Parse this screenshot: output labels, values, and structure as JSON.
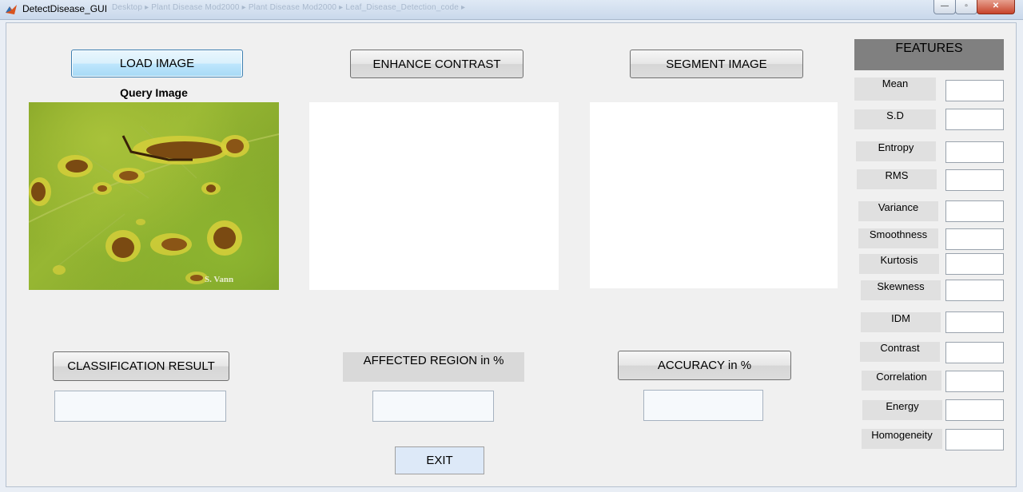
{
  "window": {
    "title": "DetectDisease_GUI",
    "ghost_path": "Desktop  ▸  Plant Disease Mod2000  ▸  Plant Disease Mod2000  ▸  Leaf_Disease_Detection_code  ▸",
    "controls": {
      "minimize": "—",
      "maximize": "▫",
      "close": "✕"
    }
  },
  "buttons": {
    "load_image": "LOAD IMAGE",
    "enhance_contrast": "ENHANCE CONTRAST",
    "segment_image": "SEGMENT IMAGE",
    "classification_result": "CLASSIFICATION RESULT",
    "accuracy": "ACCURACY in %",
    "exit": "EXIT"
  },
  "labels": {
    "query_image": "Query Image",
    "affected_region": "AFFECTED REGION in %",
    "features_title": "FEATURES",
    "watermark": "S. Vann"
  },
  "results": {
    "classification_value": "",
    "affected_region_value": "",
    "accuracy_value": ""
  },
  "features": [
    {
      "label": "Mean",
      "value": ""
    },
    {
      "label": "S.D",
      "value": ""
    },
    {
      "label": "Entropy",
      "value": ""
    },
    {
      "label": "RMS",
      "value": ""
    },
    {
      "label": "Variance",
      "value": ""
    },
    {
      "label": "Smoothness",
      "value": ""
    },
    {
      "label": "Kurtosis",
      "value": ""
    },
    {
      "label": "Skewness",
      "value": ""
    },
    {
      "label": "IDM",
      "value": ""
    },
    {
      "label": "Contrast",
      "value": ""
    },
    {
      "label": "Correlation",
      "value": ""
    },
    {
      "label": "Energy",
      "value": ""
    },
    {
      "label": "Homogeneity",
      "value": ""
    }
  ],
  "colors": {
    "button_focus": "#bee6fd",
    "features_header": "#808080",
    "leaf_green": "#8fb02f",
    "lesion_brown": "#7a4a12"
  }
}
